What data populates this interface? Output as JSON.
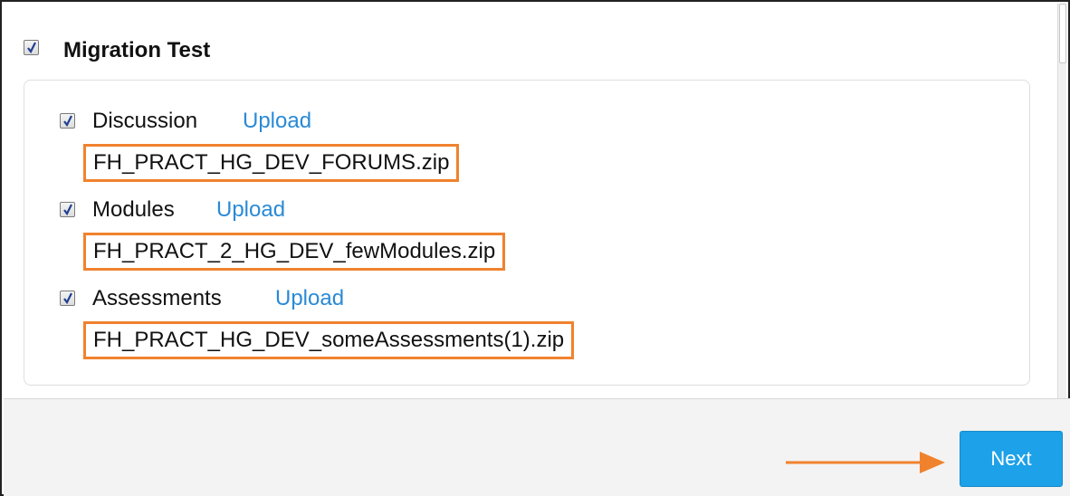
{
  "section": {
    "title": "Migration Test",
    "checked": true
  },
  "items": [
    {
      "label": "Discussion",
      "link": "Upload",
      "file": "FH_PRACT_HG_DEV_FORUMS.zip",
      "checked": true
    },
    {
      "label": "Modules",
      "link": "Upload",
      "file": "FH_PRACT_2_HG_DEV_fewModules.zip",
      "checked": true
    },
    {
      "label": "Assessments",
      "link": "Upload",
      "file": "FH_PRACT_HG_DEV_someAssessments(1).zip",
      "checked": true
    }
  ],
  "footer": {
    "next_label": "Next"
  },
  "colors": {
    "accent_link": "#2a8ad6",
    "highlight_box": "#f0822e",
    "button": "#1da1e8",
    "annotation_arrow": "#f0822e"
  },
  "icons": [
    "checkbox-checked-icon",
    "annotation-arrow-icon"
  ]
}
